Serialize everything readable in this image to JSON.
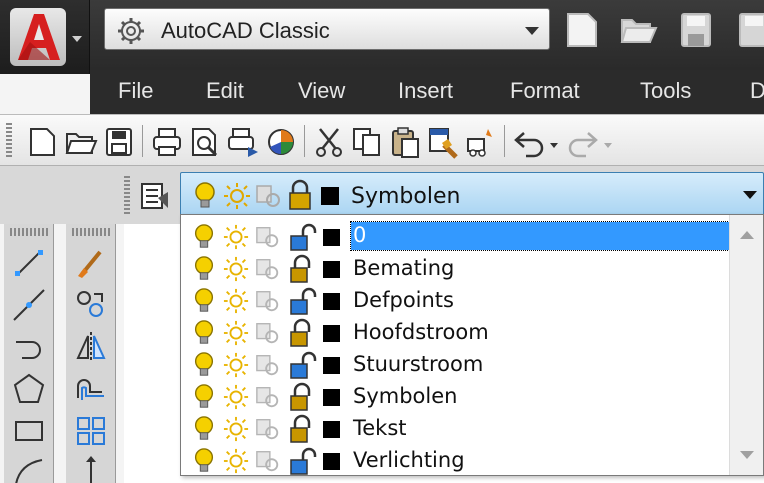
{
  "app": {
    "workspace_label": "AutoCAD Classic",
    "logo_icon": "autocad-logo-icon"
  },
  "quick_access": [
    "new-icon",
    "open-icon",
    "save-icon",
    "save-as-icon"
  ],
  "menu": {
    "items": [
      "File",
      "Edit",
      "View",
      "Insert",
      "Format",
      "Tools",
      "D"
    ]
  },
  "toolbar": {
    "buttons": [
      "new-icon",
      "open-icon",
      "save-icon",
      "plot-icon",
      "plot-preview-icon",
      "publish-icon",
      "3d-dwf-icon",
      "cut-icon",
      "copy-icon",
      "paste-icon",
      "match-properties-icon",
      "block-editor-icon",
      "undo-icon",
      "redo-icon"
    ]
  },
  "layer_control": {
    "current_layer": "Symbolen",
    "layers": [
      {
        "name": "0",
        "locked": false,
        "selected": true
      },
      {
        "name": "Bemating",
        "locked": true,
        "selected": false
      },
      {
        "name": "Defpoints",
        "locked": false,
        "selected": false
      },
      {
        "name": "Hoofdstroom",
        "locked": true,
        "selected": false
      },
      {
        "name": "Stuurstroom",
        "locked": false,
        "selected": false
      },
      {
        "name": "Symbolen",
        "locked": true,
        "selected": false
      },
      {
        "name": "Tekst",
        "locked": true,
        "selected": false
      },
      {
        "name": "Verlichting",
        "locked": false,
        "selected": false
      }
    ],
    "colors": {
      "bulb": "#f5d000",
      "sun": "#e8b400",
      "lock": "#c89600",
      "swatch": "#000000",
      "selection": "#3399ff"
    }
  },
  "draw_toolbar": [
    "line-icon",
    "construction-line-icon",
    "polyline-icon",
    "polygon-icon",
    "rectangle-icon",
    "arc-icon"
  ],
  "modify_toolbar": [
    "erase-icon",
    "copy-object-icon",
    "mirror-icon",
    "offset-icon",
    "array-icon",
    "move-icon"
  ]
}
